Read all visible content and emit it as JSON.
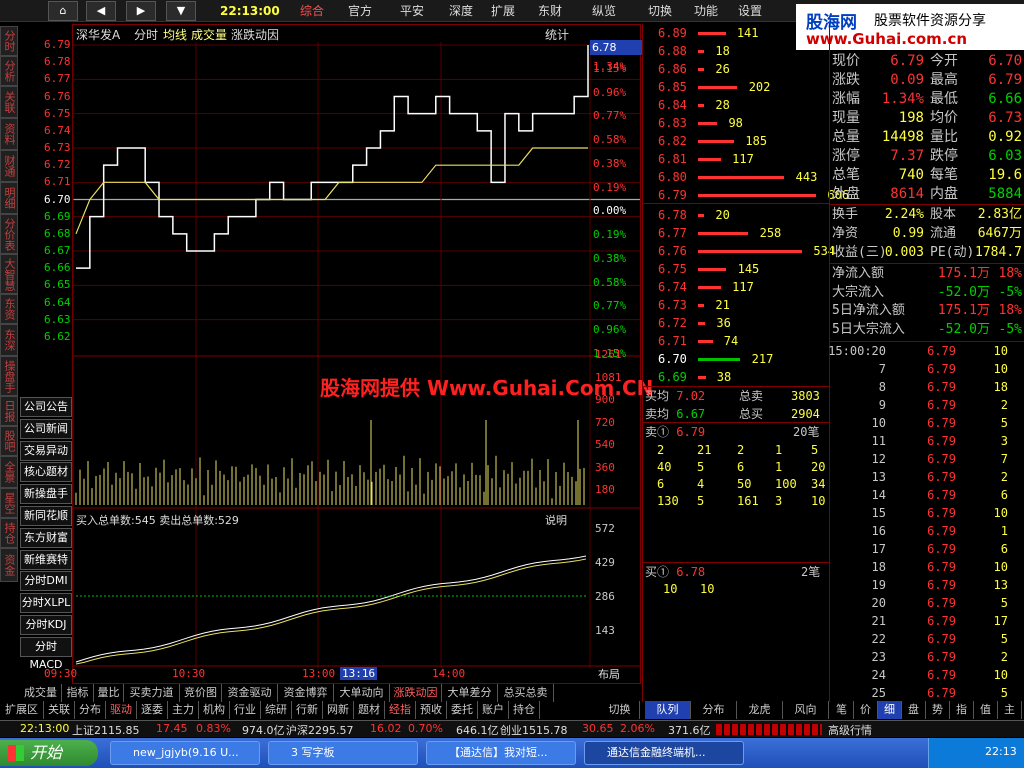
{
  "toolbar": {
    "time": "22:13:00",
    "menus": [
      "综合",
      "官方",
      "平安",
      "深度",
      "扩展",
      "东财",
      "纵览",
      "切换",
      "功能",
      "设置"
    ]
  },
  "brand": {
    "name": "股海网",
    "slogan": "股票软件资源分享",
    "url": "www.Guhai.com.cn"
  },
  "watermark": "股海网提供 Www.Guhai.Com.CN",
  "side_tabs": [
    "分时",
    "分析",
    "关联",
    "资料",
    "财通",
    "明细",
    "分价表",
    "大智慧",
    "东资",
    "东深",
    "操盘手",
    "日报",
    "股吧",
    "全景",
    "星空",
    "持仓",
    "资金"
  ],
  "chart": {
    "stock": "深华发A",
    "tabs": [
      "分时",
      "均线",
      "成交量",
      "涨跌动因"
    ],
    "stat": "统计",
    "note": "说明",
    "left_prices": [
      "6.79",
      "6.78",
      "6.77",
      "6.76",
      "6.75",
      "6.74",
      "6.73",
      "6.72",
      "6.71",
      "6.70",
      "6.69",
      "6.68",
      "6.67",
      "6.66",
      "6.65",
      "6.64",
      "6.63",
      "6.62"
    ],
    "right_pcts": [
      "1.34%",
      "1.15%",
      "0.96%",
      "0.77%",
      "0.58%",
      "0.38%",
      "0.19%",
      "0.00%",
      "0.19%",
      "0.38%",
      "0.58%",
      "0.77%",
      "0.96%",
      "1.15%"
    ],
    "cur_price": "6.78",
    "vol_ticks": [
      "1261",
      "1081",
      "900",
      "720",
      "540",
      "360",
      "180"
    ],
    "order_label": "买入总单数:545   卖出总单数:529",
    "order_ticks": [
      "572",
      "429",
      "286",
      "143"
    ],
    "time_ticks": [
      "09:30",
      "10:30",
      "13:00",
      "13:16",
      "14:00"
    ],
    "layout_btn": "布局"
  },
  "chart_data": {
    "type": "line",
    "series": [
      {
        "name": "分时",
        "values": [
          6.66,
          6.69,
          6.72,
          6.73,
          6.73,
          6.71,
          6.69,
          6.68,
          6.67,
          6.67,
          6.68,
          6.69,
          6.69,
          6.7,
          6.71,
          6.7,
          6.7,
          6.71,
          6.71,
          6.71,
          6.72,
          6.73,
          6.74,
          6.76,
          6.75,
          6.75,
          6.76,
          6.75,
          6.75,
          6.74,
          6.71,
          6.75,
          6.74,
          6.75,
          6.75,
          6.75,
          6.76,
          6.79
        ]
      },
      {
        "name": "均价",
        "values": [
          6.68,
          6.7,
          6.71,
          6.71,
          6.71,
          6.71,
          6.7,
          6.7,
          6.7,
          6.7,
          6.7,
          6.7,
          6.7,
          6.7,
          6.7,
          6.7,
          6.7,
          6.7,
          6.7,
          6.71,
          6.71,
          6.71,
          6.71,
          6.71,
          6.71,
          6.71,
          6.72,
          6.72,
          6.72,
          6.72,
          6.72,
          6.72,
          6.72,
          6.73,
          6.73,
          6.73,
          6.73,
          6.73
        ]
      }
    ],
    "ylim": [
      6.61,
      6.79
    ]
  },
  "left_buttons": [
    "公司公告",
    "公司新闻",
    "交易异动",
    "核心题材",
    "新操盘手",
    "新同花顺",
    "东方财富",
    "新维赛特",
    "分时DMI",
    "分时XLPL",
    "分时KDJ",
    "分时MACD"
  ],
  "bottom_tabs": [
    "成交量",
    "指标",
    "量比",
    "买卖力道",
    "竞价图",
    "资金驱动",
    "资金博弈",
    "大单动向",
    "涨跌动因",
    "大单差分",
    "总买总卖"
  ],
  "sector_tabs": [
    "扩展区",
    "关联",
    "分布",
    "驱动",
    "逐委",
    "主力",
    "机构",
    "行业",
    "综研",
    "行新",
    "网新",
    "题材",
    "经指",
    "预收",
    "委托",
    "账户",
    "持仓",
    "切换"
  ],
  "sell": [
    [
      "6.89",
      "141"
    ],
    [
      "6.88",
      "18"
    ],
    [
      "6.86",
      "26"
    ],
    [
      "6.85",
      "202"
    ],
    [
      "6.84",
      "28"
    ],
    [
      "6.83",
      "98"
    ],
    [
      "6.82",
      "185"
    ],
    [
      "6.81",
      "117"
    ],
    [
      "6.80",
      "443"
    ],
    [
      "6.79",
      "606"
    ]
  ],
  "buy": [
    [
      "6.78",
      "20"
    ],
    [
      "6.77",
      "258"
    ],
    [
      "6.76",
      "534"
    ],
    [
      "6.75",
      "145"
    ],
    [
      "6.74",
      "117"
    ],
    [
      "6.73",
      "21"
    ],
    [
      "6.72",
      "36"
    ],
    [
      "6.71",
      "74"
    ],
    [
      "6.70",
      "217"
    ],
    [
      "6.69",
      "38"
    ]
  ],
  "summary": {
    "buy_avg_l": "买均",
    "buy_avg": "7.02",
    "sell_total_l": "总卖",
    "sell_total": "3803",
    "sell_avg_l": "卖均",
    "sell_avg": "6.67",
    "buy_total_l": "总买",
    "buy_total": "2904"
  },
  "queue": {
    "sell1": "卖①",
    "sell1_p": "6.79",
    "sell1_n": "20笔",
    "rows": [
      [
        "2",
        "21",
        "2",
        "1",
        "5"
      ],
      [
        "40",
        "5",
        "6",
        "1",
        "20"
      ],
      [
        "6",
        "4",
        "50",
        "100",
        "34"
      ],
      [
        "130",
        "5",
        "161",
        "3",
        "10"
      ]
    ],
    "buy1": "买①",
    "buy1_p": "6.78",
    "buy1_n": "2笔",
    "buy_rows": [
      "10",
      "10"
    ]
  },
  "queue_tabs": [
    "队列",
    "分布",
    "龙虎",
    "风向"
  ],
  "quote": [
    [
      "现价",
      "6.79",
      "今开",
      "6.70"
    ],
    [
      "涨跌",
      "0.09",
      "最高",
      "6.79"
    ],
    [
      "涨幅",
      "1.34%",
      "最低",
      "6.66"
    ],
    [
      "现量",
      "198",
      "均价",
      "6.73"
    ],
    [
      "总量",
      "14498",
      "量比",
      "0.92"
    ],
    [
      "涨停",
      "7.37",
      "跌停",
      "6.03"
    ],
    [
      "总笔",
      "740",
      "每笔",
      "19.6"
    ],
    [
      "外盘",
      "8614",
      "内盘",
      "5884"
    ]
  ],
  "quote2": [
    [
      "换手",
      "2.24%",
      "股本",
      "2.83亿"
    ],
    [
      "净资",
      "0.99",
      "流通",
      "6467万"
    ],
    [
      "收益(三)",
      "0.003",
      "PE(动)",
      "1784.7"
    ]
  ],
  "flow": [
    [
      "净流入额",
      "175.1万",
      "18%"
    ],
    [
      "大宗流入",
      "-52.0万",
      "-5%"
    ],
    [
      "5日净流入额",
      "175.1万",
      "18%"
    ],
    [
      "5日大宗流入",
      "-52.0万",
      "-5%"
    ]
  ],
  "ticks": [
    [
      "15:00:20",
      "6.79",
      "10"
    ],
    [
      "7",
      "6.79",
      "10"
    ],
    [
      "8",
      "6.79",
      "18"
    ],
    [
      "9",
      "6.79",
      "2"
    ],
    [
      "10",
      "6.79",
      "5"
    ],
    [
      "11",
      "6.79",
      "3"
    ],
    [
      "12",
      "6.79",
      "7"
    ],
    [
      "13",
      "6.79",
      "2"
    ],
    [
      "14",
      "6.79",
      "6"
    ],
    [
      "15",
      "6.79",
      "10"
    ],
    [
      "16",
      "6.79",
      "1"
    ],
    [
      "17",
      "6.79",
      "6"
    ],
    [
      "18",
      "6.79",
      "10"
    ],
    [
      "19",
      "6.79",
      "13"
    ],
    [
      "20",
      "6.79",
      "5"
    ],
    [
      "21",
      "6.79",
      "17"
    ],
    [
      "22",
      "6.79",
      "5"
    ],
    [
      "23",
      "6.79",
      "2"
    ],
    [
      "24",
      "6.79",
      "10"
    ],
    [
      "25",
      "6.79",
      "5"
    ]
  ],
  "right_tabs": [
    "笔",
    "价",
    "细",
    "盘",
    "势",
    "指",
    "值",
    "主"
  ],
  "status": {
    "time": "22:13:00",
    "sh": "上证2115.85",
    "sh_chg": "17.45",
    "sh_pct": "0.83%",
    "sh_amt": "974.0亿",
    "sz": "沪深2295.57",
    "sz_chg": "16.02",
    "sz_pct": "0.70%",
    "sz_amt": "646.1亿",
    "cy": "创业1515.78",
    "cy_chg": "30.65",
    "cy_pct": "2.06%",
    "cy_amt": "371.6亿",
    "hq": "高级行情"
  },
  "taskbar": {
    "start": "开始",
    "items": [
      "new_jgjyb(9.16 U...",
      "3 写字板",
      "【通达信】我对短...",
      "通达信金融终端机..."
    ],
    "clock": "22:13"
  }
}
